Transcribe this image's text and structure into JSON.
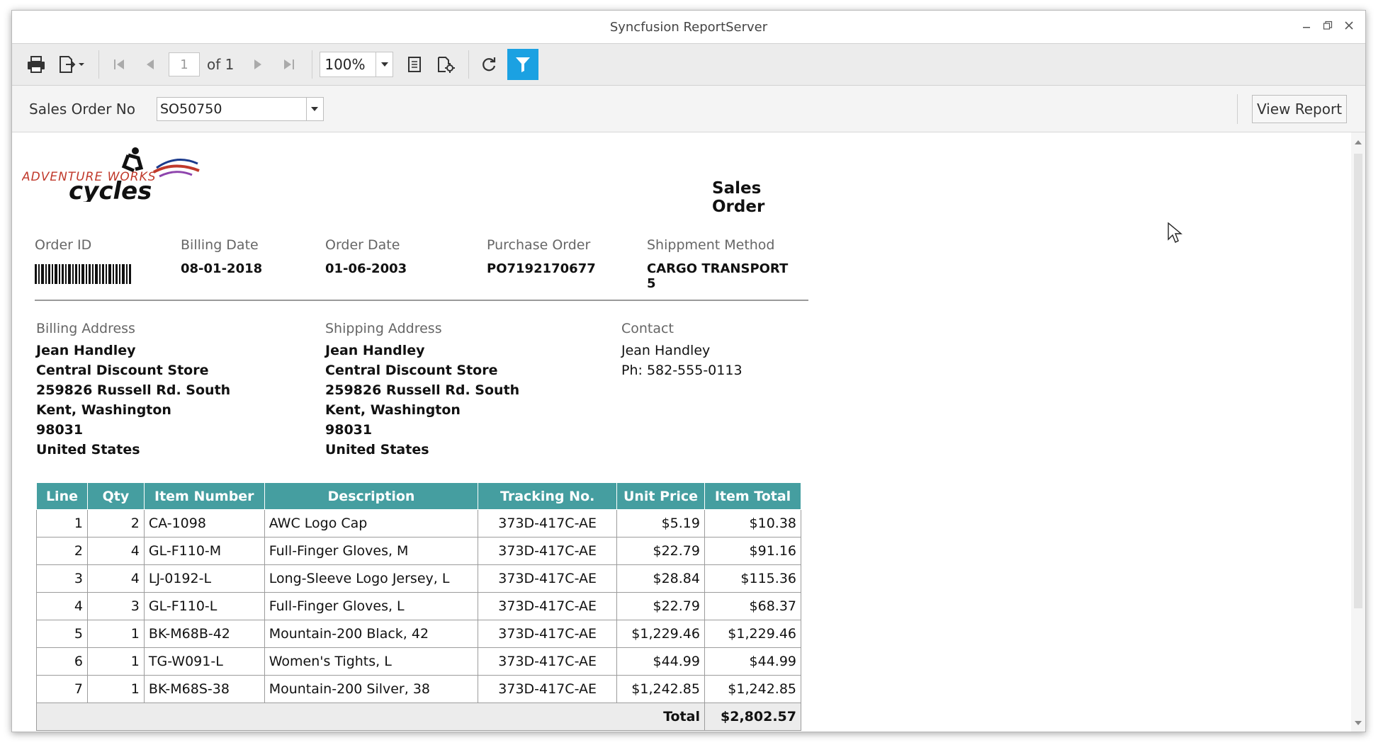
{
  "window": {
    "title": "Syncfusion ReportServer"
  },
  "toolbar": {
    "page_current": "1",
    "page_of": "of 1",
    "zoom": "100%"
  },
  "params": {
    "label": "Sales Order No",
    "value": "SO50750",
    "view_button": "View Report"
  },
  "report": {
    "logo_text_1": "ADVENTURE WORKS",
    "logo_text_2": "cycles",
    "title": "Sales Order",
    "header": {
      "order_id_label": "Order ID",
      "billing_date_label": "Billing Date",
      "billing_date": "08-01-2018",
      "order_date_label": "Order Date",
      "order_date": "01-06-2003",
      "purchase_order_label": "Purchase Order",
      "purchase_order": "PO7192170677",
      "shipment_method_label": "Shippment Method",
      "shipment_method": "CARGO TRANSPORT 5"
    },
    "billing": {
      "label": "Billing Address",
      "name": "Jean Handley",
      "store": "Central Discount Store",
      "street": "259826 Russell Rd. South",
      "city": "Kent, Washington",
      "zip": "98031",
      "country": "United States"
    },
    "shipping": {
      "label": "Shipping Address",
      "name": "Jean Handley",
      "store": "Central Discount Store",
      "street": "259826 Russell Rd. South",
      "city": "Kent, Washington",
      "zip": "98031",
      "country": "United States"
    },
    "contact": {
      "label": "Contact",
      "name": "Jean Handley",
      "phone": "Ph: 582-555-0113"
    },
    "table": {
      "columns": [
        "Line",
        "Qty",
        "Item Number",
        "Description",
        "Tracking No.",
        "Unit Price",
        "Item Total"
      ],
      "rows": [
        [
          "1",
          "2",
          "CA-1098",
          "AWC Logo Cap",
          "373D-417C-AE",
          "$5.19",
          "$10.38"
        ],
        [
          "2",
          "4",
          "GL-F110-M",
          "Full-Finger Gloves, M",
          "373D-417C-AE",
          "$22.79",
          "$91.16"
        ],
        [
          "3",
          "4",
          "LJ-0192-L",
          "Long-Sleeve Logo Jersey, L",
          "373D-417C-AE",
          "$28.84",
          "$115.36"
        ],
        [
          "4",
          "3",
          "GL-F110-L",
          "Full-Finger Gloves, L",
          "373D-417C-AE",
          "$22.79",
          "$68.37"
        ],
        [
          "5",
          "1",
          "BK-M68B-42",
          "Mountain-200 Black, 42",
          "373D-417C-AE",
          "$1,229.46",
          "$1,229.46"
        ],
        [
          "6",
          "1",
          "TG-W091-L",
          "Women's Tights, L",
          "373D-417C-AE",
          "$44.99",
          "$44.99"
        ],
        [
          "7",
          "1",
          "BK-M68S-38",
          "Mountain-200 Silver, 38",
          "373D-417C-AE",
          "$1,242.85",
          "$1,242.85"
        ]
      ],
      "total_label": "Total",
      "total_value": "$2,802.57"
    }
  },
  "colors": {
    "table_header": "#459ea0",
    "filter_active": "#1ba1e2"
  },
  "icons": [
    "print-icon",
    "export-icon",
    "first-page-icon",
    "prev-page-icon",
    "next-page-icon",
    "last-page-icon",
    "page-setup-icon",
    "print-layout-icon",
    "refresh-icon",
    "filter-icon"
  ]
}
